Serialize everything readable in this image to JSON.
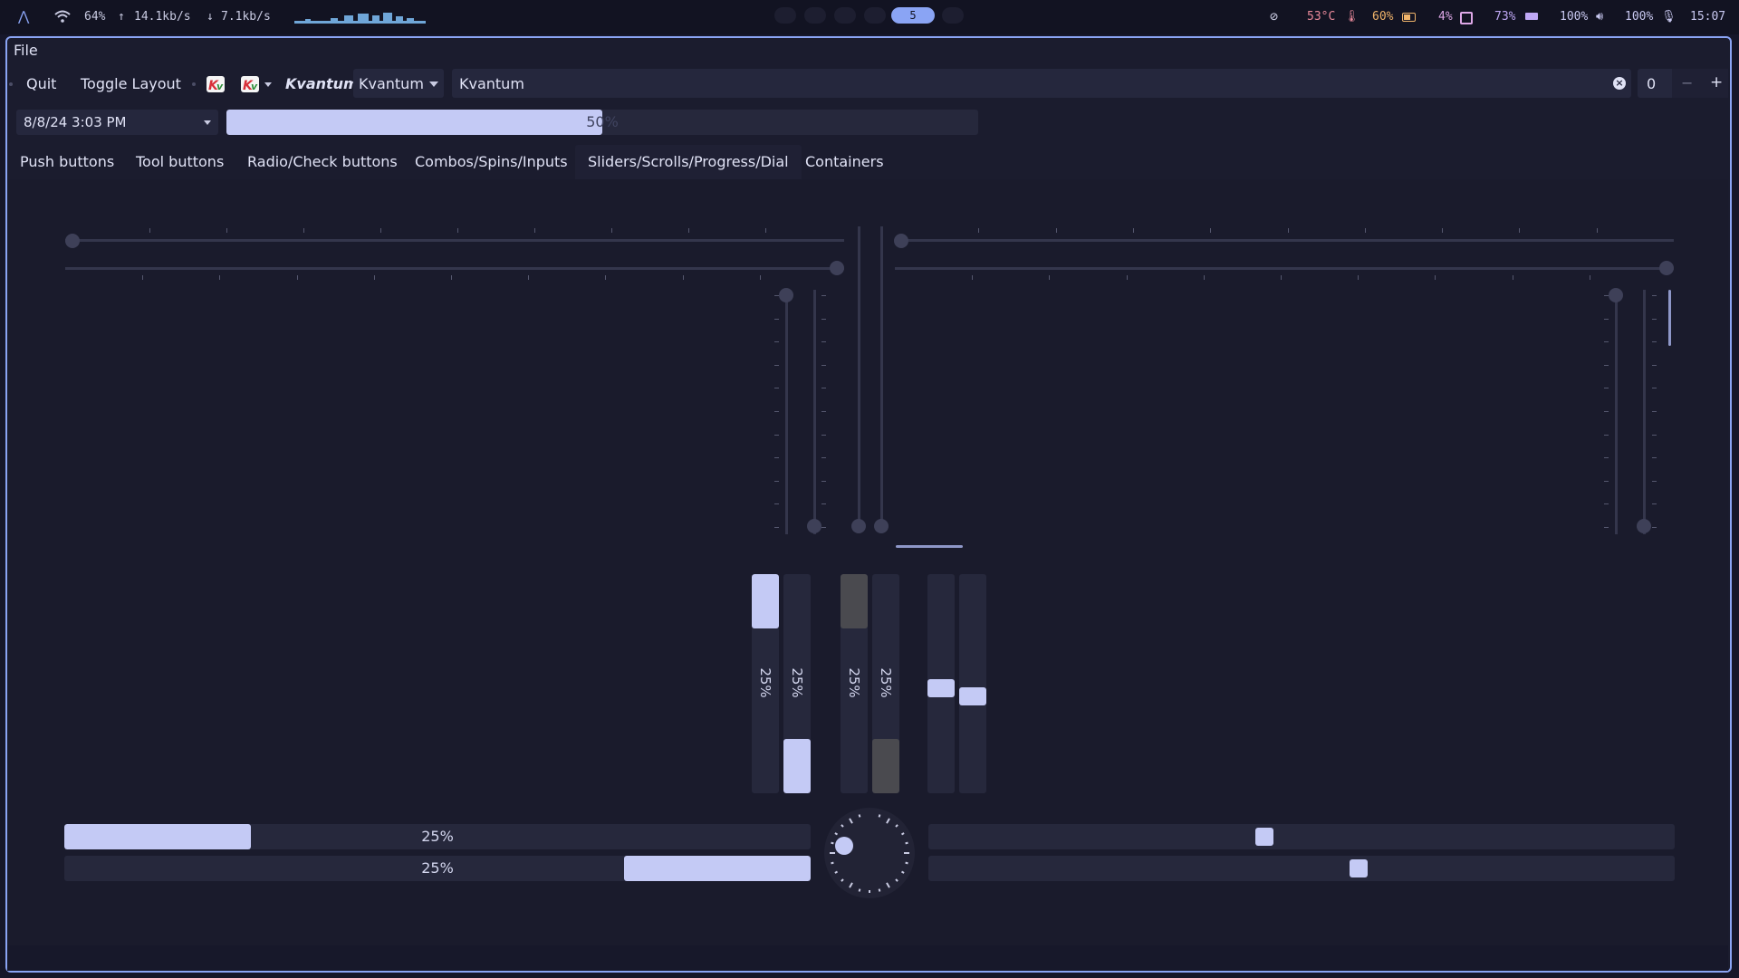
{
  "topbar": {
    "launcher_icon": "arch-icon",
    "wifi_icon": "wifi-icon",
    "wifi_strength": "64%",
    "upload": "14.1kb/s",
    "download": "7.1kb/s",
    "active_workspace": "5",
    "temperature": "53°C",
    "battery": "60%",
    "cpu": "4%",
    "memory": "73%",
    "volume": "100%",
    "mic": "100%",
    "clock": "15:07",
    "colors": {
      "accent": "#8aa4f4",
      "temp": "#e8899a",
      "battery": "#f0b46a",
      "cpu": "#dda7e6",
      "memory": "#bfa8f5",
      "volume": "#c8c8f0"
    }
  },
  "menu": {
    "file": "File"
  },
  "toolbar": {
    "quit": "Quit",
    "toggle_layout": "Toggle Layout",
    "kvantum_label": "Kvantum",
    "combo_value": "Kvantum",
    "line_edit_value": "Kvantum",
    "spin_value": "0",
    "spin_minus": "−",
    "spin_plus": "+"
  },
  "row2": {
    "datetime": "8/8/24 3:03 PM",
    "progress_text": "50%",
    "progress_value": 0.5
  },
  "tabs": [
    {
      "label": "Push buttons"
    },
    {
      "label": "Tool buttons"
    },
    {
      "label": "Radio/Check buttons"
    },
    {
      "label": "Combos/Spins/Inputs"
    },
    {
      "label": "Sliders/Scrolls/Progress/Dial"
    },
    {
      "label": "Containers"
    }
  ],
  "active_tab": 4,
  "progress": {
    "vertical_labels": [
      "25%",
      "25%",
      "25%",
      "25%"
    ],
    "horizontal_1": {
      "text": "25%",
      "value": 0.25
    },
    "horizontal_2": {
      "text": "25%",
      "value": 0.25
    }
  }
}
